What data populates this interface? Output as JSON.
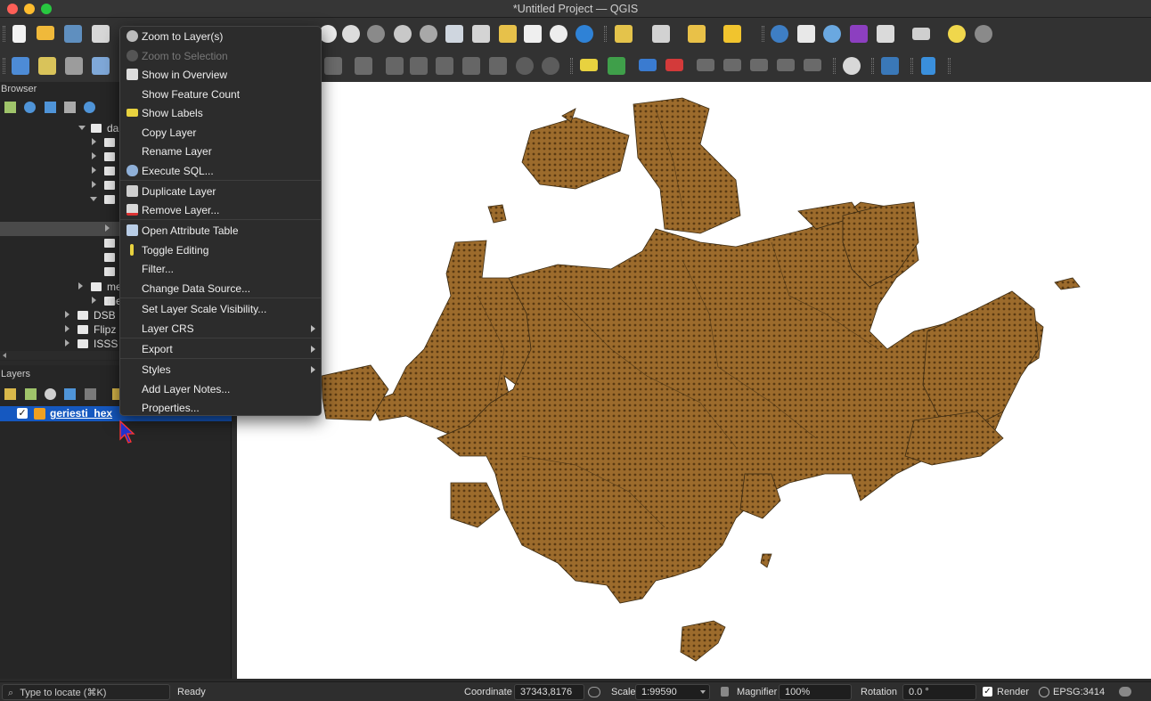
{
  "window": {
    "title": "*Untitled Project — QGIS"
  },
  "colors": {
    "hex_fill": "#9c6b2c",
    "selection": "#1558c0",
    "menu_bg": "#2c2c2c"
  },
  "browser_panel": {
    "title": "Browser",
    "rows": [
      {
        "label": "da",
        "expanded": true
      },
      {
        "label": ""
      },
      {
        "label": ""
      },
      {
        "label": ""
      },
      {
        "label": ""
      },
      {
        "label": "",
        "expanded": true
      },
      {
        "label": ""
      },
      {
        "label": ""
      },
      {
        "label": ""
      },
      {
        "label": ""
      },
      {
        "label": "me"
      },
      {
        "label": "me"
      },
      {
        "label": "DSB"
      },
      {
        "label": "Flipz"
      },
      {
        "label": "ISSS"
      }
    ]
  },
  "layers_panel": {
    "title": "Layers",
    "layers": [
      {
        "name": "geriesti_hex",
        "checked": true
      }
    ]
  },
  "context_menu": {
    "items": [
      {
        "label": "Zoom to Layer(s)",
        "icon": "zoom-layer-icon"
      },
      {
        "label": "Zoom to Selection",
        "icon": "zoom-selection-icon",
        "disabled": true
      },
      {
        "label": "Show in Overview",
        "icon": "overview-icon"
      },
      {
        "label": "Show Feature Count",
        "icon": ""
      },
      {
        "label": "Show Labels",
        "icon": "labels-icon"
      },
      {
        "label": "Copy Layer",
        "icon": ""
      },
      {
        "label": "Rename Layer",
        "icon": ""
      },
      {
        "label": "Execute SQL...",
        "icon": "database-icon"
      },
      {
        "label": "Duplicate Layer",
        "icon": "duplicate-icon"
      },
      {
        "label": "Remove Layer...",
        "icon": "remove-icon"
      },
      {
        "label": "Open Attribute Table",
        "icon": "table-icon"
      },
      {
        "label": "Toggle Editing",
        "icon": "pencil-icon"
      },
      {
        "label": "Filter...",
        "icon": ""
      },
      {
        "label": "Change Data Source...",
        "icon": ""
      },
      {
        "label": "Set Layer Scale Visibility...",
        "icon": ""
      },
      {
        "label": "Layer CRS",
        "icon": "",
        "submenu": true
      },
      {
        "label": "Export",
        "icon": "",
        "submenu": true
      },
      {
        "label": "Styles",
        "icon": "",
        "submenu": true
      },
      {
        "label": "Add Layer Notes...",
        "icon": ""
      },
      {
        "label": "Properties...",
        "icon": ""
      }
    ]
  },
  "status_bar": {
    "locator_placeholder": "Type to locate (⌘K)",
    "ready": "Ready",
    "coordinate_label": "Coordinate",
    "coordinate_value": "37343,8176",
    "scale_label": "Scale",
    "scale_value": "1:99590",
    "magnifier_label": "Magnifier",
    "magnifier_value": "100%",
    "rotation_label": "Rotation",
    "rotation_value": "0.0 °",
    "render_label": "Render",
    "render_checked": true,
    "crs": "EPSG:3414"
  }
}
